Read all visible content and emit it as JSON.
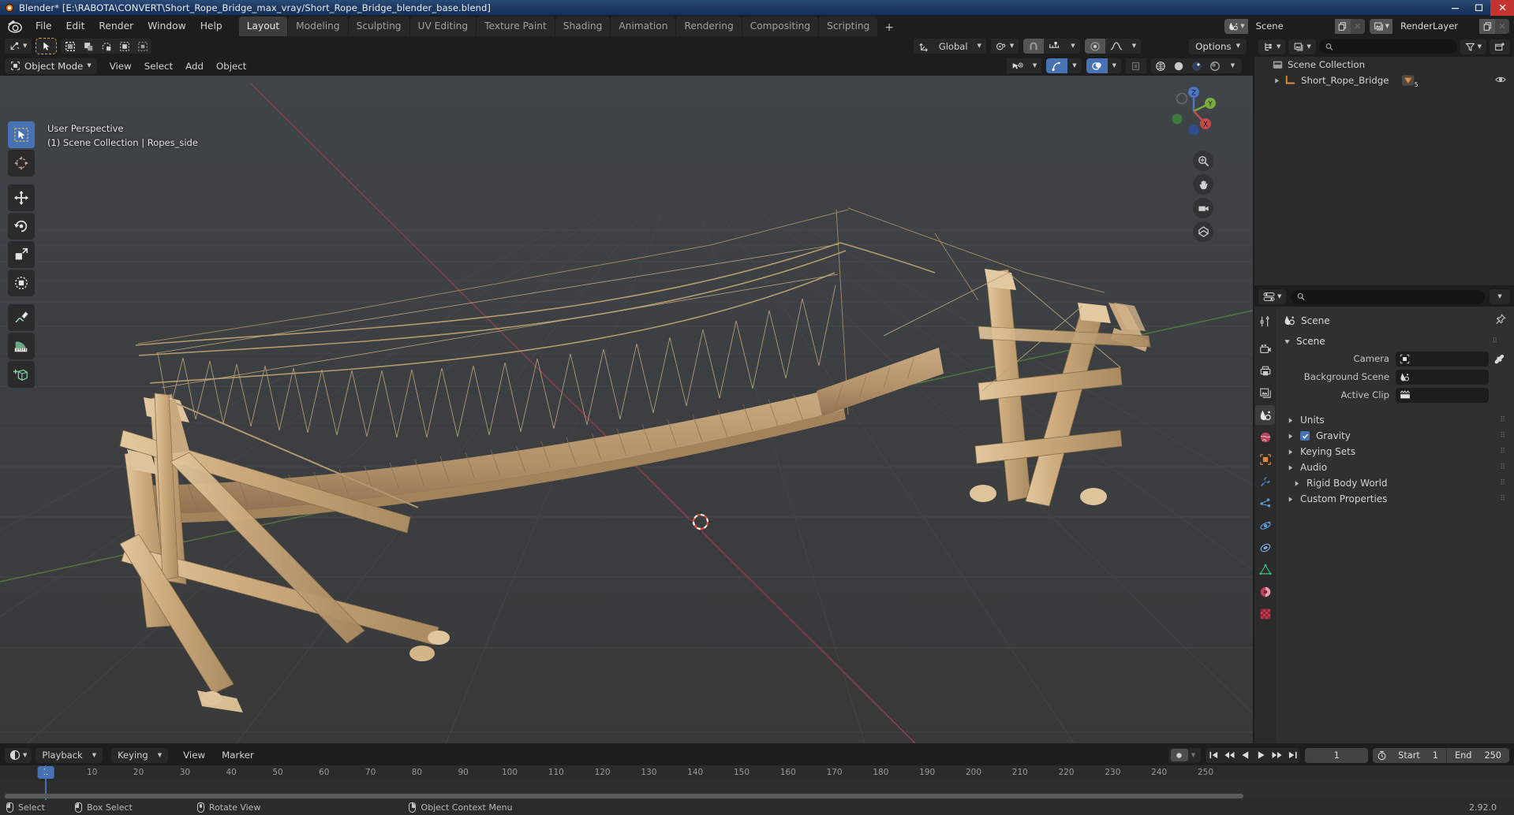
{
  "titlebar": {
    "title": "Blender* [E:\\RABOTA\\CONVERT\\Short_Rope_Bridge_max_vray/Short_Rope_Bridge_blender_base.blend]",
    "minimize": "minimize-icon",
    "maximize": "maximize-icon",
    "close": "close-icon"
  },
  "topbar": {
    "menus": [
      "File",
      "Edit",
      "Render",
      "Window",
      "Help"
    ],
    "workspaces": [
      "Layout",
      "Modeling",
      "Sculpting",
      "UV Editing",
      "Texture Paint",
      "Shading",
      "Animation",
      "Rendering",
      "Compositing",
      "Scripting"
    ],
    "active_workspace": "Layout",
    "add_workspace": "+",
    "scene_name": "Scene",
    "view_layer_name": "RenderLayer"
  },
  "viewport": {
    "mode": "Object Mode",
    "menus": [
      "View",
      "Select",
      "Add",
      "Object"
    ],
    "transform_orientation": "Global",
    "options_label": "Options",
    "overlay_line1": "User Perspective",
    "overlay_line2": "(1) Scene Collection | Ropes_side",
    "tools": [
      "tweak-select-tool",
      "cursor-tool",
      "move-tool",
      "rotate-tool",
      "scale-tool",
      "transform-tool",
      "annotate-tool",
      "measure-tool",
      "add-cube-tool"
    ],
    "gizmo_axes": [
      "Z",
      "Y",
      "X"
    ],
    "nav_buttons": [
      "zoom-icon",
      "pan-hand-icon",
      "camera-view-icon",
      "toggle-ortho-icon"
    ],
    "select_modes": [
      "select-box-icon",
      "select-circle-icon",
      "select-lasso-icon",
      "select-tweak-icon",
      "select-extend-icon"
    ],
    "shading_modes": [
      "wireframe-shading",
      "solid-shading",
      "material-preview-shading",
      "rendered-shading"
    ],
    "active_shading": "material-preview-shading"
  },
  "outliner": {
    "search_placeholder": "",
    "display_mode": "view-layer-icon",
    "rows": [
      {
        "label": "Scene Collection",
        "icon": "collection-icon",
        "indent": 0,
        "badge": null
      },
      {
        "label": "Short_Rope_Bridge",
        "icon": "collection-child-icon",
        "indent": 1,
        "badge": "5"
      }
    ]
  },
  "properties": {
    "search_placeholder": "",
    "breadcrumb": "Scene",
    "panel_title": "Scene",
    "fields": [
      {
        "label": "Camera",
        "value": "",
        "icon": "camera-data-icon",
        "eyedropper": true
      },
      {
        "label": "Background Scene",
        "value": "",
        "icon": "scene-icon",
        "eyedropper": false
      },
      {
        "label": "Active Clip",
        "value": "",
        "icon": "movie-clip-icon",
        "eyedropper": false
      }
    ],
    "sections": [
      {
        "label": "Units",
        "checkbox": null
      },
      {
        "label": "Gravity",
        "checkbox": true
      },
      {
        "label": "Keying Sets",
        "checkbox": null
      },
      {
        "label": "Audio",
        "checkbox": null
      },
      {
        "label": "Rigid Body World",
        "checkbox": null
      },
      {
        "label": "Custom Properties",
        "checkbox": null
      }
    ],
    "tabs": [
      "tool-tab",
      "render-tab",
      "output-tab",
      "view-layer-tab",
      "scene-tab",
      "world-tab",
      "object-tab",
      "modifier-tab",
      "particles-tab",
      "physics-tab",
      "constraints-tab",
      "object-data-tab",
      "material-tab",
      "texture-tab"
    ],
    "active_tab": "scene-tab"
  },
  "timeline": {
    "editor_icon": "timeline-editor-icon",
    "menus": [
      "Playback",
      "Keying",
      "View",
      "Marker"
    ],
    "current_frame": "1",
    "start_label": "Start",
    "start_value": "1",
    "end_label": "End",
    "end_value": "250",
    "ruler_ticks": [
      "10",
      "20",
      "30",
      "40",
      "50",
      "60",
      "70",
      "80",
      "90",
      "100",
      "110",
      "120",
      "130",
      "140",
      "150",
      "160",
      "170",
      "180",
      "190",
      "200",
      "210",
      "220",
      "230",
      "240",
      "250"
    ],
    "playback_buttons": [
      "jump-start-icon",
      "prev-keyframe-icon",
      "play-reverse-icon",
      "play-icon",
      "next-keyframe-icon",
      "jump-end-icon"
    ],
    "record_button": "auto-keying-icon"
  },
  "statusbar": {
    "hints": [
      {
        "mouse": "left-mouse-icon",
        "label": "Select"
      },
      {
        "mouse": "left-mouse-drag-icon",
        "label": "Box Select"
      },
      {
        "mouse": "middle-mouse-icon",
        "label": "Rotate View"
      },
      {
        "mouse": "right-mouse-icon",
        "label": "Object Context Menu"
      }
    ],
    "version": "2.92.0"
  },
  "colors": {
    "accent_blue": "#4772b3",
    "blender_orange": "#e87d0d",
    "viewport_bg": "#3c3c3c",
    "panel_bg": "#303030",
    "header_bg": "#1d1d1d",
    "axis_x": "#9b3f4a",
    "axis_y": "#5c8a3a"
  }
}
